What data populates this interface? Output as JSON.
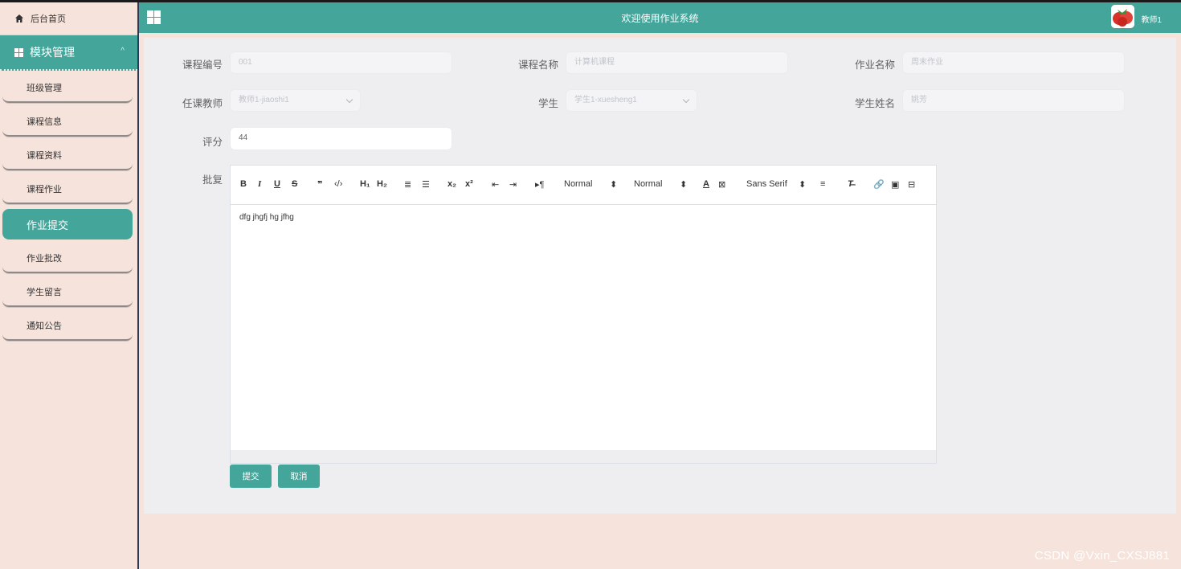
{
  "header": {
    "title": "欢迎使用作业系统",
    "user": "教师1"
  },
  "sidebar": {
    "home": "后台首页",
    "module": "模块管理",
    "items": [
      {
        "label": "班级管理"
      },
      {
        "label": "课程信息"
      },
      {
        "label": "课程资料"
      },
      {
        "label": "课程作业"
      },
      {
        "label": "作业提交"
      },
      {
        "label": "作业批改"
      },
      {
        "label": "学生留言"
      },
      {
        "label": "通知公告"
      }
    ]
  },
  "form": {
    "course_no": {
      "label": "课程编号",
      "value": "001"
    },
    "course_name": {
      "label": "课程名称",
      "value": "计算机课程"
    },
    "homework_name": {
      "label": "作业名称",
      "value": "周末作业"
    },
    "teacher": {
      "label": "任课教师",
      "value": "教师1-jiaoshi1"
    },
    "student": {
      "label": "学生",
      "value": "学生1-xuesheng1"
    },
    "student_name": {
      "label": "学生姓名",
      "value": "姚芳"
    },
    "score": {
      "label": "评分",
      "value": "44"
    },
    "reply": {
      "label": "批复",
      "text": "dfg jhgfj hg jfhg"
    }
  },
  "toolbar": {
    "h1": "H₁",
    "h2": "H₂",
    "sub": "x₂",
    "sup": "x²",
    "header_select": "Normal",
    "size_select": "Normal",
    "font_select": "Sans Serif"
  },
  "buttons": {
    "submit": "提交",
    "cancel": "取消"
  },
  "watermark": "CSDN @Vxin_CXSJ881",
  "colors": {
    "accent": "#44a69b",
    "sidebar_bg": "#f6e3dc"
  }
}
